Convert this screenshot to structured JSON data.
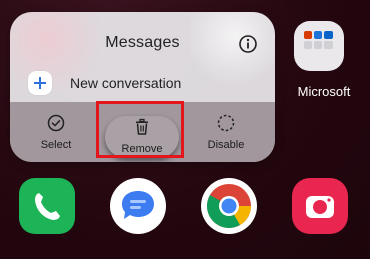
{
  "popup": {
    "title": "Messages",
    "new_conversation_label": "New conversation",
    "actions": [
      {
        "label": "Select",
        "icon": "check-circle-icon"
      },
      {
        "label": "Remove",
        "icon": "trash-icon"
      },
      {
        "label": "Disable",
        "icon": "dashed-circle-icon"
      }
    ]
  },
  "folder": {
    "label": "Microsoft"
  },
  "dock": {
    "apps": [
      {
        "icon": "phone-app-icon"
      },
      {
        "icon": "messages-app-icon"
      },
      {
        "icon": "chrome-app-icon"
      },
      {
        "icon": "camera-app-icon"
      }
    ]
  },
  "colors": {
    "highlight": "#e3161c",
    "phone": "#1db357",
    "messages": "#3c7bf0",
    "camera": "#e8264f",
    "wallpaper": "#2a0a12"
  }
}
